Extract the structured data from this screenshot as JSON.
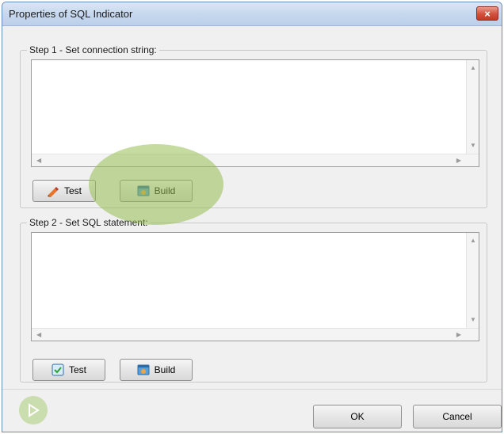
{
  "window": {
    "title": "Properties of SQL Indicator",
    "close_label": "×"
  },
  "step1": {
    "legend": "Step 1 - Set connection string:",
    "value": "",
    "test_label": "Test",
    "build_label": "Build"
  },
  "step2": {
    "legend": "Step 2 - Set SQL statement:",
    "value": "",
    "test_label": "Test",
    "build_label": "Build"
  },
  "footer": {
    "ok_label": "OK",
    "cancel_label": "Cancel"
  },
  "icons": {
    "step1_test": "pencil-icon",
    "step1_build": "build-icon",
    "step2_test": "checkbox-icon",
    "step2_build": "build-icon",
    "play": "play-icon"
  },
  "colors": {
    "highlight": "#96be50",
    "close": "#c23a24"
  }
}
